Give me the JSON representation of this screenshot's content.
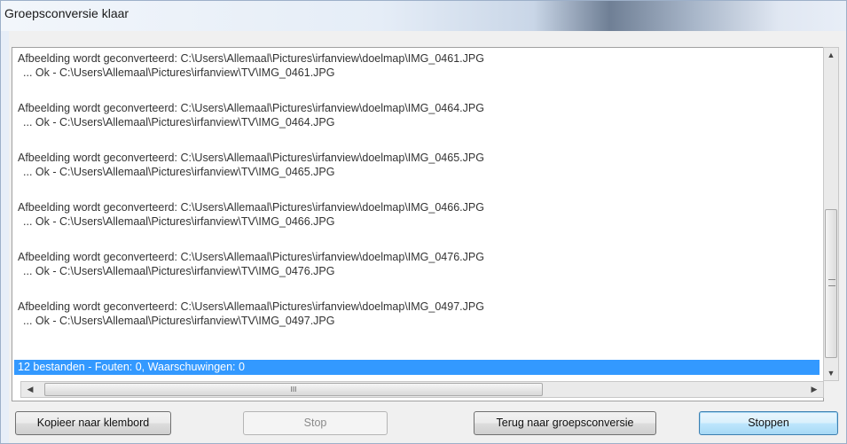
{
  "window": {
    "title": "Groepsconversie klaar"
  },
  "log": {
    "entries": [
      {
        "line1": "Afbeelding wordt geconverteerd: C:\\Users\\Allemaal\\Pictures\\irfanview\\doelmap\\IMG_0461.JPG",
        "line2": "... Ok - C:\\Users\\Allemaal\\Pictures\\irfanview\\TV\\IMG_0461.JPG"
      },
      {
        "line1": "Afbeelding wordt geconverteerd: C:\\Users\\Allemaal\\Pictures\\irfanview\\doelmap\\IMG_0464.JPG",
        "line2": "... Ok - C:\\Users\\Allemaal\\Pictures\\irfanview\\TV\\IMG_0464.JPG"
      },
      {
        "line1": "Afbeelding wordt geconverteerd: C:\\Users\\Allemaal\\Pictures\\irfanview\\doelmap\\IMG_0465.JPG",
        "line2": "... Ok - C:\\Users\\Allemaal\\Pictures\\irfanview\\TV\\IMG_0465.JPG"
      },
      {
        "line1": "Afbeelding wordt geconverteerd: C:\\Users\\Allemaal\\Pictures\\irfanview\\doelmap\\IMG_0466.JPG",
        "line2": "... Ok - C:\\Users\\Allemaal\\Pictures\\irfanview\\TV\\IMG_0466.JPG"
      },
      {
        "line1": "Afbeelding wordt geconverteerd: C:\\Users\\Allemaal\\Pictures\\irfanview\\doelmap\\IMG_0476.JPG",
        "line2": "... Ok - C:\\Users\\Allemaal\\Pictures\\irfanview\\TV\\IMG_0476.JPG"
      },
      {
        "line1": "Afbeelding wordt geconverteerd: C:\\Users\\Allemaal\\Pictures\\irfanview\\doelmap\\IMG_0497.JPG",
        "line2": "... Ok - C:\\Users\\Allemaal\\Pictures\\irfanview\\TV\\IMG_0497.JPG"
      }
    ],
    "status": "12 bestanden - Fouten: 0, Waarschuwingen: 0"
  },
  "scrollbar": {
    "up": "▲",
    "down": "▼",
    "left": "◀",
    "right": "▶",
    "grip": "III"
  },
  "buttons": {
    "copy": "Kopieer naar klembord",
    "stop": "Stop",
    "back": "Terug naar groepsconversie",
    "quit": "Stoppen"
  },
  "colors": {
    "selection": "#3399ff"
  }
}
